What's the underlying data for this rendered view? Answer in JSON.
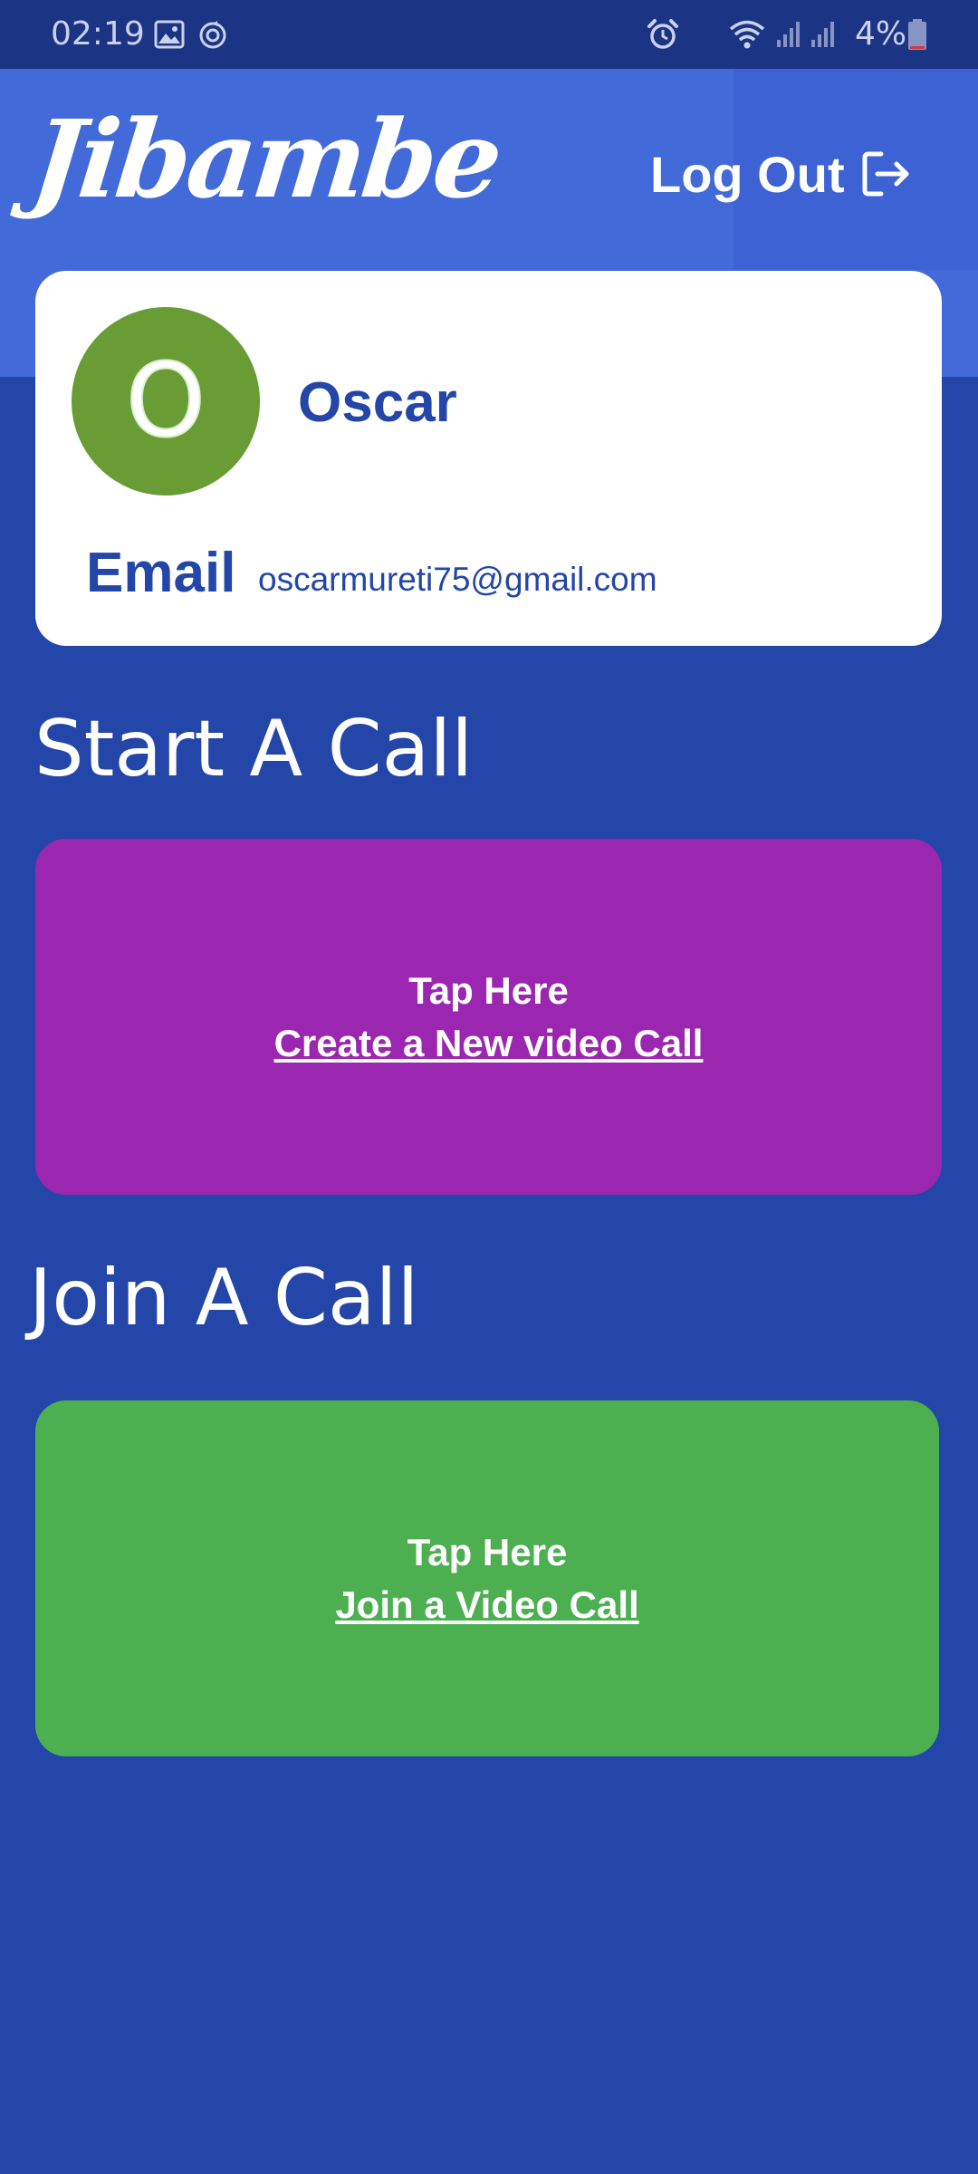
{
  "status_bar": {
    "time": "02:19",
    "battery_text": "4%",
    "icons": [
      "image-icon",
      "sync-icon",
      "alarm-icon",
      "wifi-icon",
      "signal-icon",
      "battery-icon"
    ]
  },
  "header": {
    "logo_text": "Jibambe",
    "logout_label": "Log Out"
  },
  "profile": {
    "initial": "O",
    "name": "Oscar",
    "email_label": "Email",
    "email": "oscarmureti75@gmail.com"
  },
  "start_call": {
    "heading": "Start A Call",
    "tile_line1": "Tap Here",
    "tile_line2": "Create a New video Call"
  },
  "join_call": {
    "heading": "Join A Call",
    "tile_line1": "Tap Here",
    "tile_line2": "Join a Video Call"
  },
  "colors": {
    "background": "#2346a8",
    "header": "#426bd9",
    "avatar": "#6a9c36",
    "start_tile": "#9b27b0",
    "join_tile": "#4caf50"
  }
}
